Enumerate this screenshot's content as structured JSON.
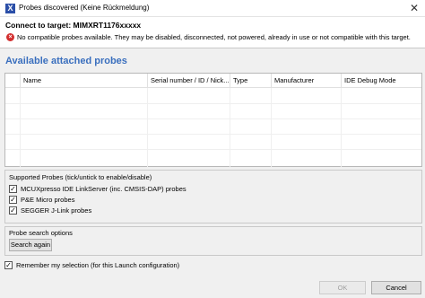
{
  "window": {
    "title": "Probes discovered (Keine Rückmeldung)",
    "icon_glyph": "X",
    "close_glyph": "✕"
  },
  "header": {
    "title": "Connect to target: MIMXRT1176xxxxx",
    "error_glyph": "×",
    "error_message": "No compatible probes available. They may be disabled, disconnected, not powered, already in use or not compatible with this target."
  },
  "probes": {
    "section_title": "Available attached probes",
    "columns": [
      "Name",
      "Serial number / ID / Nick...",
      "Type",
      "Manufacturer",
      "IDE Debug Mode"
    ],
    "rows": []
  },
  "supported_probes": {
    "title": "Supported Probes (tick/untick to enable/disable)",
    "items": [
      {
        "label": "MCUXpresso IDE LinkServer (inc. CMSIS-DAP) probes",
        "checked": true
      },
      {
        "label": "P&E Micro probes",
        "checked": true
      },
      {
        "label": "SEGGER J-Link probes",
        "checked": true
      }
    ]
  },
  "search_options": {
    "title": "Probe search options",
    "search_again_label": "Search again"
  },
  "remember": {
    "label": "Remember my selection (for this Launch configuration)",
    "checked": true
  },
  "footer": {
    "ok_label": "OK",
    "cancel_label": "Cancel"
  },
  "colors": {
    "section_title": "#3a6fbe",
    "error_icon": "#d32f2f",
    "app_icon": "#2b4fa8"
  },
  "check_glyph": "✓"
}
